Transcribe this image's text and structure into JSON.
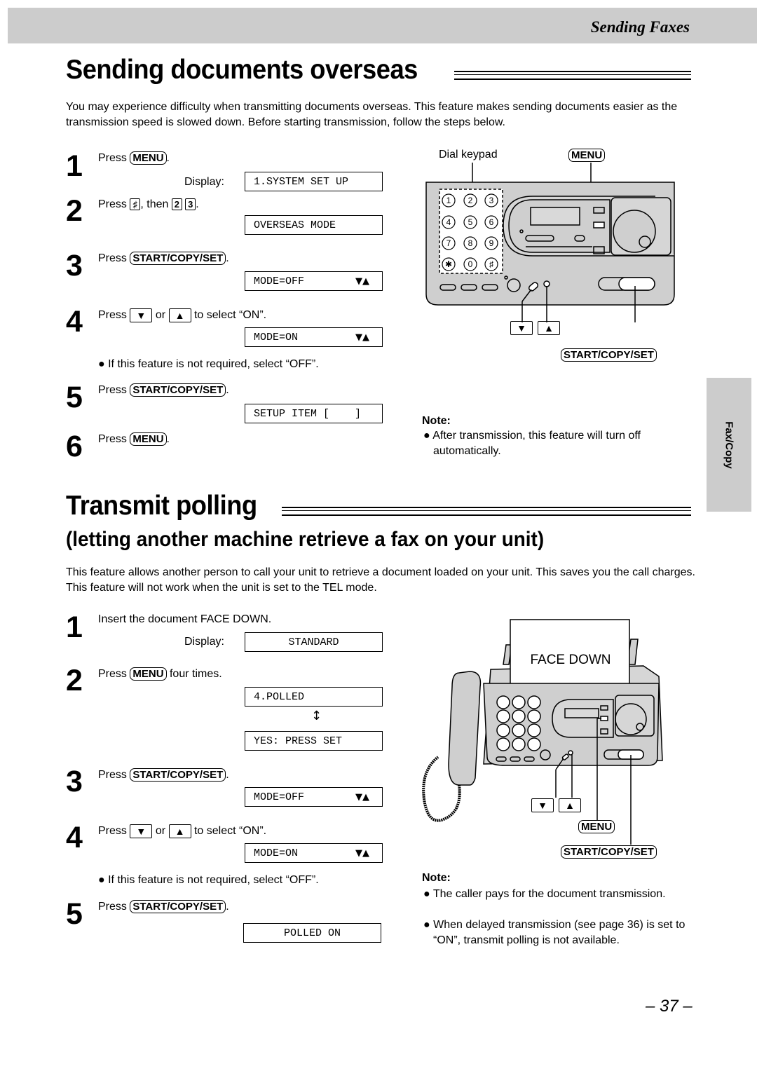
{
  "header": {
    "section_title": "Sending Faxes"
  },
  "side_tab": {
    "label": "Fax/Copy"
  },
  "overseas": {
    "title": "Sending documents overseas",
    "intro": "You may experience difficulty when transmitting documents overseas. This feature makes sending documents easier as the transmission speed is slowed down. Before starting transmission, follow the steps below.",
    "steps": [
      {
        "num": "1",
        "press": "Press",
        "key": "MENU",
        "after": ".",
        "display_label": "Display:",
        "lcd": "1.SYSTEM SET UP"
      },
      {
        "num": "2",
        "press": "Press",
        "key1": "♯",
        "mid": ", then",
        "key2": "2",
        "key3": "3",
        "after": ".",
        "lcd": "OVERSEAS MODE"
      },
      {
        "num": "3",
        "press": "Press",
        "key": "START/COPY/SET",
        "after": ".",
        "lcd": "MODE=OFF",
        "lcd_arrows": "▼▲"
      },
      {
        "num": "4",
        "press": "Press",
        "down": "▼",
        "or": "or",
        "up": "▲",
        "after": "to select “ON”.",
        "lcd": "MODE=ON",
        "lcd_arrows": "▼▲",
        "bullet": "If this feature is not required, select “OFF”."
      },
      {
        "num": "5",
        "press": "Press",
        "key": "START/COPY/SET",
        "after": ".",
        "lcd": "SETUP ITEM [    ]"
      },
      {
        "num": "6",
        "press": "Press",
        "key": "MENU",
        "after": "."
      }
    ],
    "diagram": {
      "dial_keypad_label": "Dial keypad",
      "menu_label": "MENU",
      "start_label": "START/COPY/SET",
      "down_label": "▼",
      "up_label": "▲",
      "keypad": [
        "1",
        "2",
        "3",
        "4",
        "5",
        "6",
        "7",
        "8",
        "9",
        "✱",
        "0",
        "♯"
      ]
    },
    "note": {
      "title": "Note:",
      "items": [
        "After transmission, this feature will turn off automatically."
      ]
    }
  },
  "polling": {
    "title": "Transmit polling",
    "subtitle": "(letting another machine retrieve a fax on your unit)",
    "intro": "This feature allows another person to call your unit to retrieve a document loaded on your unit. This saves you the call charges. This feature will not work when the unit is set to the TEL mode.",
    "steps": [
      {
        "num": "1",
        "text": "Insert the document FACE DOWN.",
        "display_label": "Display:",
        "lcd": "STANDARD"
      },
      {
        "num": "2",
        "press": "Press",
        "key": "MENU",
        "after": "four times.",
        "lcd": "4.POLLED",
        "lcd2": "YES: PRESS SET",
        "swap_icon": "↕"
      },
      {
        "num": "3",
        "press": "Press",
        "key": "START/COPY/SET",
        "after": ".",
        "lcd": "MODE=OFF",
        "lcd_arrows": "▼▲"
      },
      {
        "num": "4",
        "press": "Press",
        "down": "▼",
        "or": "or",
        "up": "▲",
        "after": "to select “ON”.",
        "lcd": "MODE=ON",
        "lcd_arrows": "▼▲",
        "bullet": "If this feature is not required, select “OFF”."
      },
      {
        "num": "5",
        "press": "Press",
        "key": "START/COPY/SET",
        "after": ".",
        "lcd": "POLLED ON"
      }
    ],
    "diagram": {
      "paper_label": "FACE DOWN",
      "menu_label": "MENU",
      "start_label": "START/COPY/SET",
      "down_label": "▼",
      "up_label": "▲"
    },
    "note": {
      "title": "Note:",
      "items": [
        "The caller pays for the document transmission.",
        "When delayed transmission (see page 36) is set to “ON”, transmit polling is not available."
      ]
    }
  },
  "footer": {
    "page_number": "– 37 –"
  }
}
